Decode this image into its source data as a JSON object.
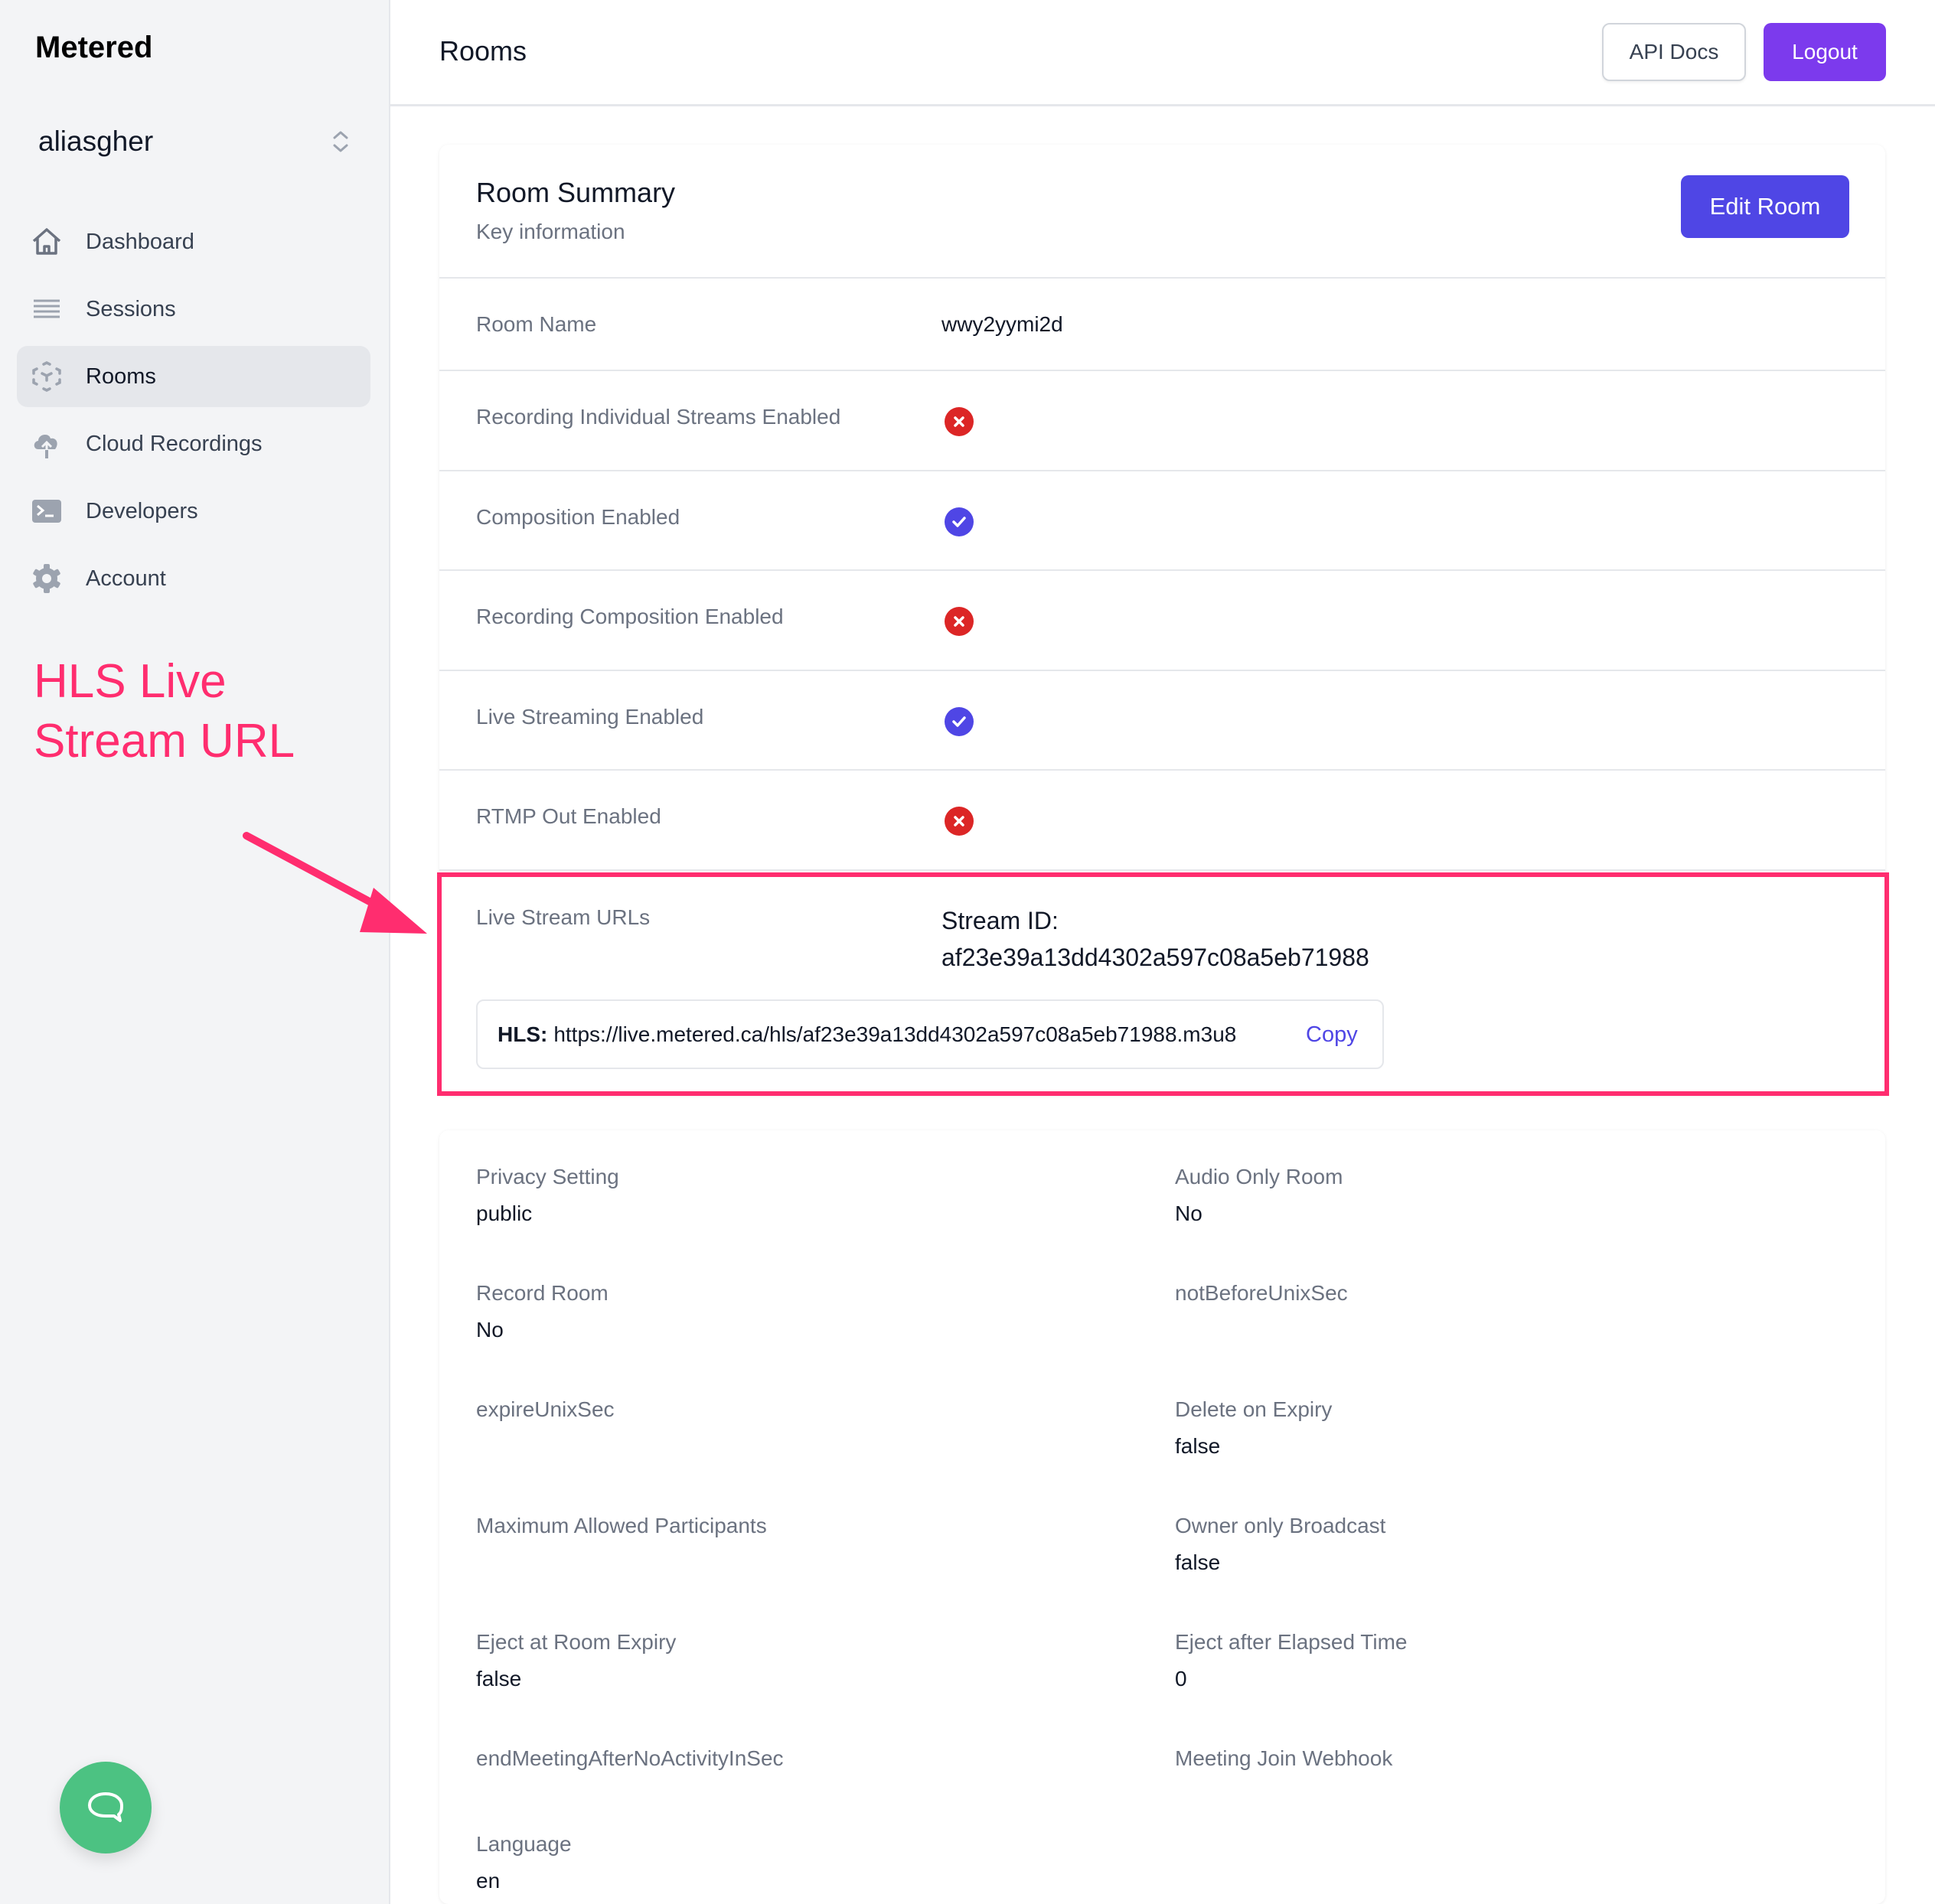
{
  "sidebar": {
    "brand": "Metered",
    "account": "aliasgher",
    "items": [
      {
        "label": "Dashboard",
        "icon": "home-icon",
        "active": false
      },
      {
        "label": "Sessions",
        "icon": "list-icon",
        "active": false
      },
      {
        "label": "Rooms",
        "icon": "cube-icon",
        "active": true
      },
      {
        "label": "Cloud Recordings",
        "icon": "cloud-upload-icon",
        "active": false
      },
      {
        "label": "Developers",
        "icon": "terminal-icon",
        "active": false
      },
      {
        "label": "Account",
        "icon": "gear-icon",
        "active": false
      }
    ]
  },
  "annotation": {
    "text": "HLS Live Stream URL",
    "color": "#ff2d6f"
  },
  "header": {
    "title": "Rooms",
    "api_docs": "API Docs",
    "logout": "Logout"
  },
  "summary": {
    "title": "Room Summary",
    "subtitle": "Key information",
    "edit_button": "Edit Room",
    "room_name_label": "Room Name",
    "room_name_value": "wwy2yymi2d",
    "flags": [
      {
        "label": "Recording Individual Streams Enabled",
        "enabled": false
      },
      {
        "label": "Composition Enabled",
        "enabled": true
      },
      {
        "label": "Recording Composition Enabled",
        "enabled": false
      },
      {
        "label": "Live Streaming Enabled",
        "enabled": true
      },
      {
        "label": "RTMP Out Enabled",
        "enabled": false
      }
    ],
    "live_stream": {
      "label": "Live Stream URLs",
      "stream_id_label": "Stream ID:",
      "stream_id": "af23e39a13dd4302a597c08a5eb71988",
      "hls_label": "HLS:",
      "hls_url": "https://live.metered.ca/hls/af23e39a13dd4302a597c08a5eb71988.m3u8",
      "copy": "Copy"
    }
  },
  "details": [
    {
      "label": "Privacy Setting",
      "value": "public"
    },
    {
      "label": "Audio Only Room",
      "value": "No"
    },
    {
      "label": "Record Room",
      "value": "No"
    },
    {
      "label": "notBeforeUnixSec",
      "value": ""
    },
    {
      "label": "expireUnixSec",
      "value": ""
    },
    {
      "label": "Delete on Expiry",
      "value": "false"
    },
    {
      "label": "Maximum Allowed Participants",
      "value": ""
    },
    {
      "label": "Owner only Broadcast",
      "value": "false"
    },
    {
      "label": "Eject at Room Expiry",
      "value": "false"
    },
    {
      "label": "Eject after Elapsed Time",
      "value": "0"
    },
    {
      "label": "endMeetingAfterNoActivityInSec",
      "value": ""
    },
    {
      "label": "Meeting Join Webhook",
      "value": ""
    },
    {
      "label": "Language",
      "value": "en"
    }
  ],
  "colors": {
    "primary": "#4f46e5",
    "logout": "#7c3aed",
    "error": "#dc2626",
    "chat": "#4cc282"
  }
}
